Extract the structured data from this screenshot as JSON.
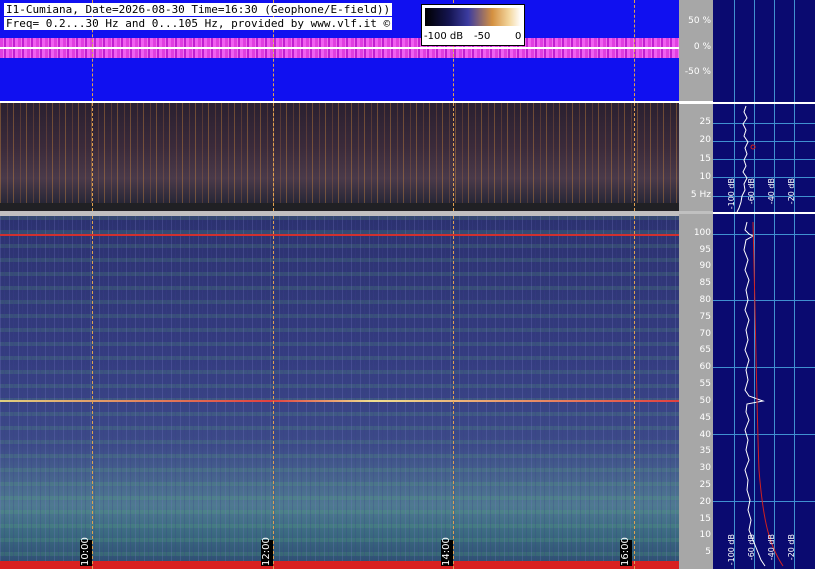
{
  "title": {
    "line1": "I1-Cumiana, Date=2026-08-30 Time=16:30 (Geophone/E-field))",
    "line2": "Freq= 0.2...30 Hz and 0...105 Hz, provided by www.vlf.it ©"
  },
  "colorbar": {
    "labels": [
      "-100 dB",
      "-50",
      "0"
    ]
  },
  "waveform_scale": [
    "50 %",
    "0 %",
    "-50 %"
  ],
  "spectrogram1_scale": [
    "25",
    "20",
    "15",
    "10",
    "5 Hz"
  ],
  "spectrogram2_scale": [
    "100",
    "95",
    "90",
    "85",
    "80",
    "75",
    "70",
    "65",
    "60",
    "55",
    "50",
    "45",
    "40",
    "35",
    "30",
    "25",
    "20",
    "15",
    "10",
    "5"
  ],
  "time_markers": [
    "10:00",
    "12:00",
    "14:00",
    "16:00"
  ],
  "side_db_labels_top": [
    "-100 dB",
    "-60 dB",
    "-40 dB",
    "-20 dB"
  ],
  "side_db_labels_bottom": [
    "-100 dB",
    "-60 dB",
    "-40 dB",
    "-20 dB"
  ],
  "colors": {
    "waveform_bg": "#1010f0",
    "waveform_signal": "#e040e0",
    "side_panel": "#0a0a70",
    "grid": "#4090d0",
    "line_50hz": "#e03030",
    "line_100hz": "#e03030"
  }
}
